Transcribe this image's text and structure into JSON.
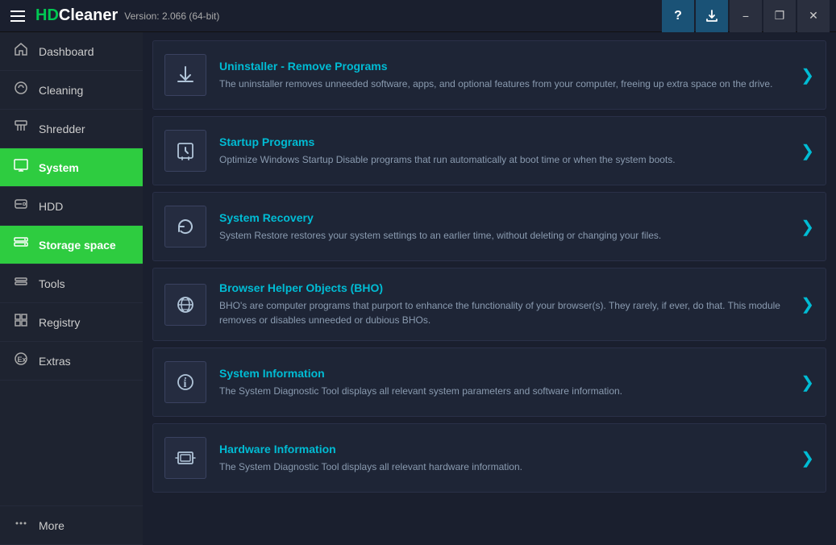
{
  "app": {
    "title": "HDCleaner",
    "version": "Version: 2.066 (64-bit)",
    "logo_highlight": "HD"
  },
  "titlebar": {
    "help_label": "?",
    "minimize_label": "−",
    "maximize_label": "❐",
    "close_label": "✕"
  },
  "sidebar": {
    "items": [
      {
        "id": "dashboard",
        "label": "Dashboard",
        "icon": "home"
      },
      {
        "id": "cleaning",
        "label": "Cleaning",
        "icon": "cleaning"
      },
      {
        "id": "shredder",
        "label": "Shredder",
        "icon": "shredder"
      },
      {
        "id": "system",
        "label": "System",
        "icon": "system",
        "active": true
      },
      {
        "id": "hdd",
        "label": "HDD",
        "icon": "hdd"
      },
      {
        "id": "storage-space",
        "label": "Storage space",
        "icon": "storage"
      },
      {
        "id": "tools",
        "label": "Tools",
        "icon": "tools"
      },
      {
        "id": "registry",
        "label": "Registry",
        "icon": "registry"
      },
      {
        "id": "extras",
        "label": "Extras",
        "icon": "extras"
      },
      {
        "id": "more",
        "label": "More",
        "icon": "more"
      }
    ]
  },
  "cards": [
    {
      "id": "uninstaller",
      "title": "Uninstaller - Remove Programs",
      "desc": "The uninstaller removes unneeded software, apps, and optional features from your computer, freeing up extra space on the drive."
    },
    {
      "id": "startup",
      "title": "Startup Programs",
      "desc": "Optimize Windows Startup Disable programs that run automatically at boot time or when the system boots."
    },
    {
      "id": "system-recovery",
      "title": "System Recovery",
      "desc": "System Restore restores your system settings to an earlier time, without deleting or changing your files."
    },
    {
      "id": "bho",
      "title": "Browser Helper Objects (BHO)",
      "desc": "BHO's are computer programs that purport to enhance the functionality of your browser(s). They rarely, if ever, do that. This module removes or disables unneeded or dubious BHOs."
    },
    {
      "id": "system-info",
      "title": "System Information",
      "desc": "The System Diagnostic Tool displays all relevant system parameters and software information."
    },
    {
      "id": "hardware-info",
      "title": "Hardware Information",
      "desc": "The System Diagnostic Tool displays all relevant hardware information."
    }
  ]
}
